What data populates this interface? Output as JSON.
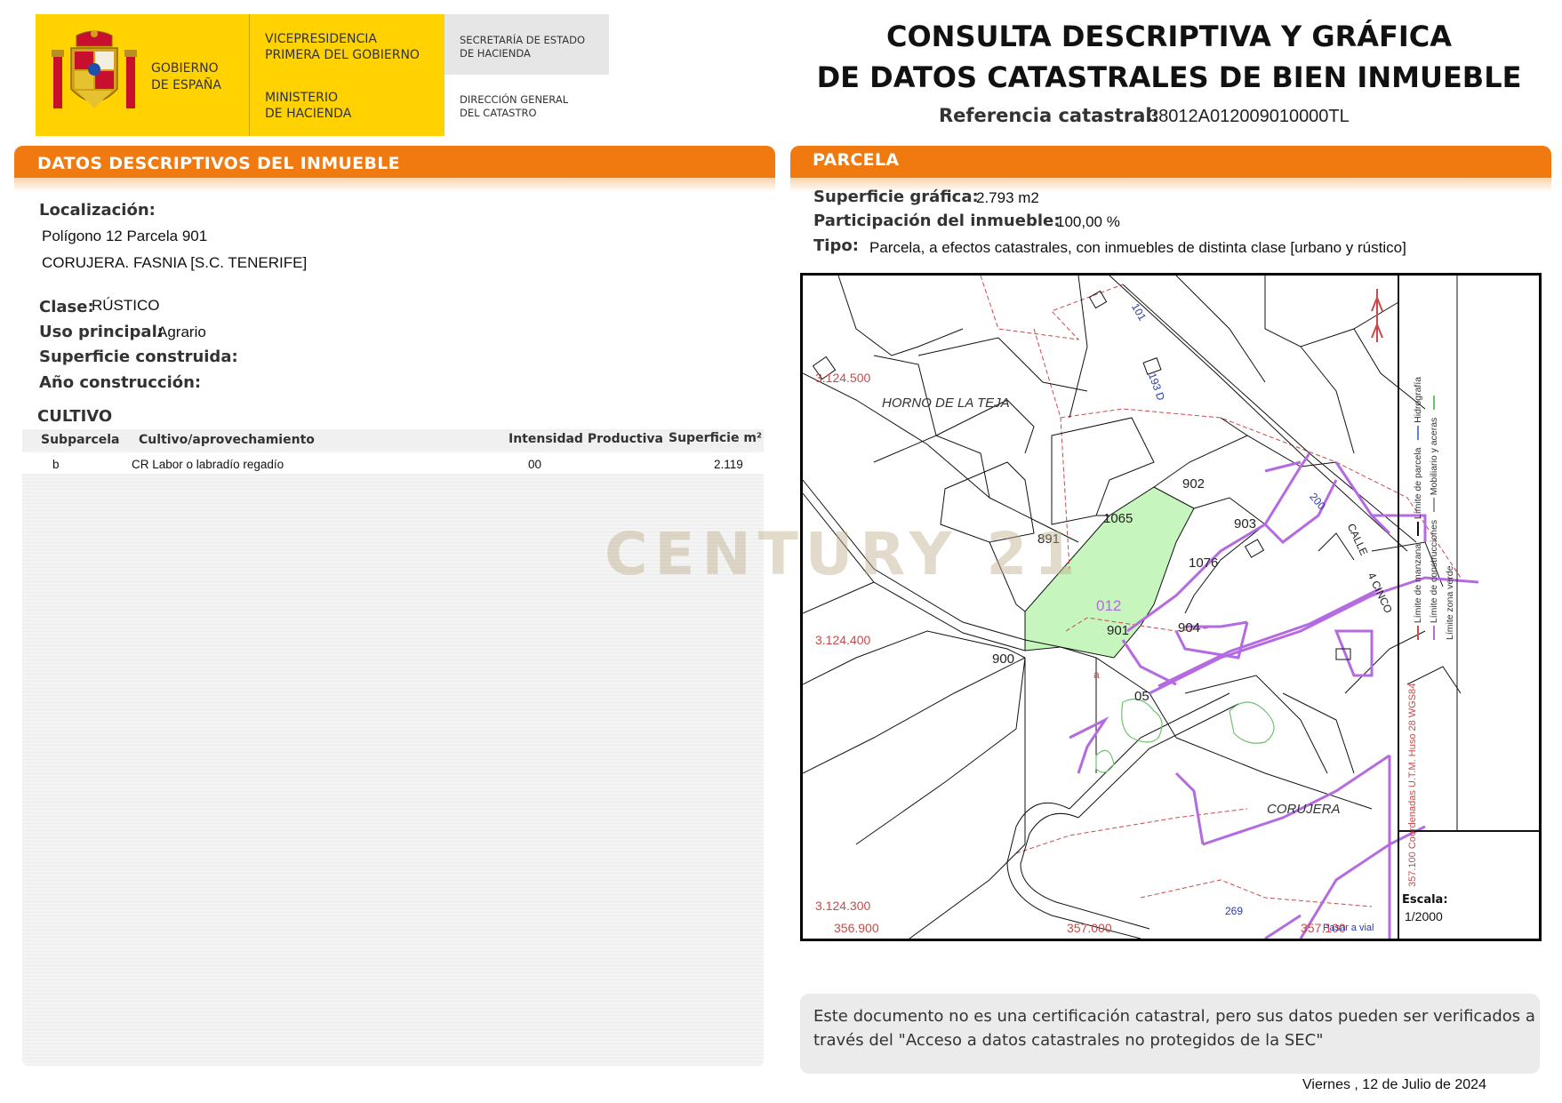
{
  "header": {
    "gov_line1": "GOBIERNO",
    "gov_line2": "DE ESPAÑA",
    "vp_line1": "VICEPRESIDENCIA",
    "vp_line2": "PRIMERA DEL GOBIERNO",
    "min_line1": "MINISTERIO",
    "min_line2": "DE HACIENDA",
    "sec_line1": "SECRETARÍA DE ESTADO",
    "sec_line2": "DE HACIENDA",
    "dg_line1": "DIRECCIÓN GENERAL",
    "dg_line2": "DEL CATASTRO",
    "title_line1": "CONSULTA DESCRIPTIVA Y GRÁFICA",
    "title_line2": "DE DATOS CATASTRALES DE BIEN INMUEBLE",
    "ref_label": "Referencia catastral:",
    "ref_value": "38012A012009010000TL"
  },
  "left": {
    "section_title": "DATOS DESCRIPTIVOS DEL INMUEBLE",
    "loc_label": "Localización:",
    "loc_line1": "Polígono 12 Parcela 901",
    "loc_line2": "CORUJERA. FASNIA [S.C. TENERIFE]",
    "clase_label": "Clase:",
    "clase_value": "RÚSTICO",
    "uso_label": "Uso principal:",
    "uso_value": "Agrario",
    "sup_label": "Superficie construida:",
    "anio_label": "Año construcción:",
    "cultivo_title": "CULTIVO",
    "table": {
      "headers": [
        "Subparcela",
        "Cultivo/aprovechamiento",
        "Intensidad Productiva",
        "Superficie m²"
      ],
      "rows": [
        {
          "subparcela": "b",
          "cultivo": "CR Labor o labradío regadío",
          "intensidad": "00",
          "superficie": "2.119"
        }
      ]
    }
  },
  "right": {
    "section_title": "PARCELA",
    "sup_grafica_label": "Superficie gráfica:",
    "sup_grafica_value": "2.793 m2",
    "participacion_label": "Participación del inmueble:",
    "participacion_value": "100,00 %",
    "tipo_label": "Tipo:",
    "tipo_value": "Parcela, a efectos catastrales, con inmuebles de distinta clase [urbano y rústico]"
  },
  "map": {
    "place_names": [
      "HORNO DE LA TEJA",
      "CORUJERA"
    ],
    "parcel_labels": [
      "902",
      "903",
      "1065",
      "891",
      "1076",
      "901",
      "904",
      "900",
      "05",
      "012",
      "a"
    ],
    "coord_labels_y": [
      "3.124.500",
      "3.124.400",
      "3.124.300"
    ],
    "coord_labels_x": [
      "356.900",
      "357.000",
      "357.100"
    ],
    "road_labels": [
      "101",
      "193 D",
      "200",
      "CALLE",
      "4 CINCO",
      "269",
      "Pasar a vial"
    ],
    "legend_items": [
      "Límite de manzana",
      "Límite de parcela",
      "Hidrografía",
      "Límite de construcciones",
      "Mobiliario y aceras",
      "Límite zona verde"
    ],
    "coords_system": "357.100 Coordenadas U.T.M. Huso 28 WGS84",
    "escala_label": "Escala:",
    "escala_value": "1/2000",
    "colors": {
      "parcel_fill": "#c6f5bd",
      "construction": "#b46ae0",
      "manzana": "#c84a4a",
      "green_zone": "#6fc06f"
    }
  },
  "footer": {
    "note_line1": "Este documento no es una certificación catastral, pero sus datos pueden ser verificados a",
    "note_line2": "través del \"Acceso a datos catastrales no protegidos de la SEC\"",
    "date": "Viernes , 12 de Julio de 2024"
  },
  "watermark": "CENTURY 21"
}
